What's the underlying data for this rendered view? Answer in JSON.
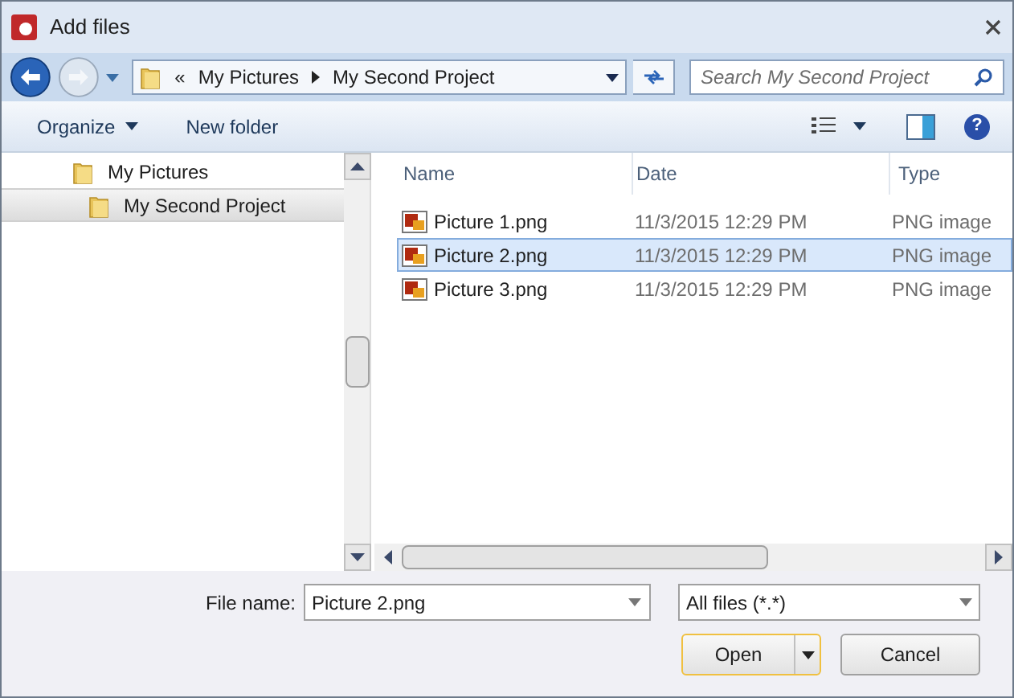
{
  "window": {
    "title": "Add files"
  },
  "address": {
    "overflow": "«",
    "crumbs": [
      "My Pictures",
      "My Second Project"
    ]
  },
  "search": {
    "placeholder": "Search My Second Project"
  },
  "toolbar": {
    "organize": "Organize",
    "new_folder": "New folder",
    "help": "?"
  },
  "tree": [
    {
      "label": "My Pictures",
      "selected": false,
      "children": [
        {
          "label": "My Second Project",
          "selected": true
        }
      ]
    }
  ],
  "table": {
    "columns": [
      "Name",
      "Date",
      "Type"
    ],
    "rows": [
      {
        "name": "Picture 1.png",
        "date": "11/3/2015 12:29 PM",
        "type": "PNG image",
        "selected": false
      },
      {
        "name": "Picture 2.png",
        "date": "11/3/2015 12:29 PM",
        "type": "PNG image",
        "selected": true
      },
      {
        "name": "Picture 3.png",
        "date": "11/3/2015 12:29 PM",
        "type": "PNG image",
        "selected": false
      }
    ]
  },
  "file_name": {
    "label": "File name:",
    "value": "Picture 2.png"
  },
  "filter": {
    "value": "All files (*.*)"
  },
  "buttons": {
    "open": "Open",
    "cancel": "Cancel"
  }
}
